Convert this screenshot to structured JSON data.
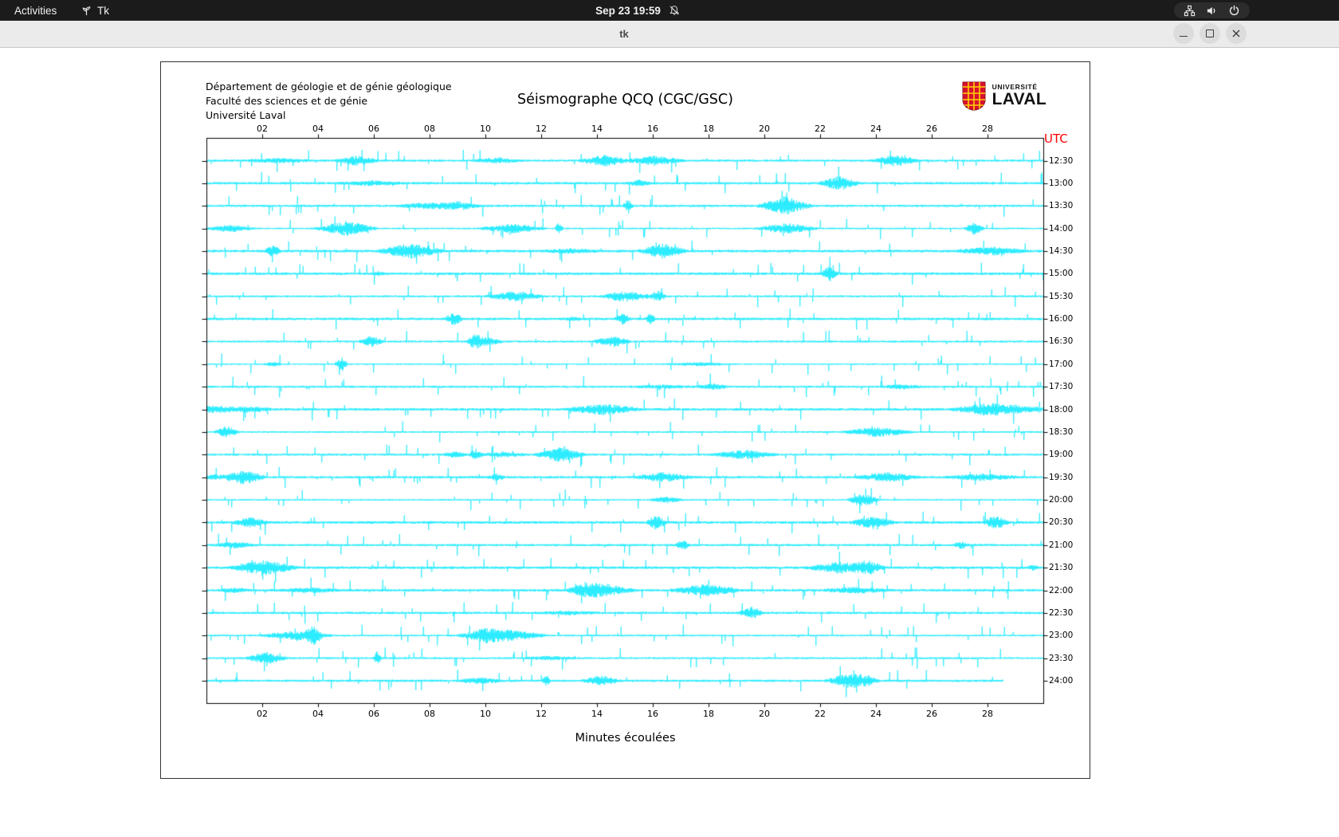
{
  "colors": {
    "trace_cyan": "#00e8ff",
    "utc_red": "#ff0000",
    "topbar_bg": "#1b1b1b",
    "titlebar_bg": "#ebebeb"
  },
  "top_bar": {
    "activities": "Activities",
    "app_name": "Tk",
    "clock": "Sep 23 19:59"
  },
  "window": {
    "title": "tk"
  },
  "figure": {
    "header_lines": [
      "Département de géologie et de génie géologique",
      "Faculté des sciences et de génie",
      "Université Laval"
    ],
    "title": "Séismographe QCQ (CGC/GSC)",
    "utc_label": "UTC",
    "xlabel": "Minutes écoulées",
    "logo": {
      "line1": "UNIVERSITÉ",
      "line2": "LAVAL"
    }
  },
  "chart_data": {
    "type": "line",
    "subtype": "seismogram-helicorder",
    "title": "Séismographe QCQ (CGC/GSC)",
    "xlabel": "Minutes écoulées",
    "right_axis_label": "UTC",
    "x_range_minutes": [
      0,
      30
    ],
    "x_tick_minutes": [
      2,
      4,
      6,
      8,
      10,
      12,
      14,
      16,
      18,
      20,
      22,
      24,
      26,
      28
    ],
    "x_tick_labels": [
      "02",
      "04",
      "06",
      "08",
      "10",
      "12",
      "14",
      "16",
      "18",
      "20",
      "22",
      "24",
      "26",
      "28"
    ],
    "trace_labels": [
      "12:30",
      "13:00",
      "13:30",
      "14:00",
      "14:30",
      "15:00",
      "15:30",
      "16:00",
      "16:30",
      "17:00",
      "17:30",
      "18:00",
      "18:30",
      "19:00",
      "19:30",
      "20:00",
      "20:30",
      "21:00",
      "21:30",
      "22:00",
      "22:30",
      "23:00",
      "23:30",
      "24:00"
    ],
    "trace_color": "#00e8ff",
    "last_trace_fraction": 0.952,
    "seed": 923
  }
}
